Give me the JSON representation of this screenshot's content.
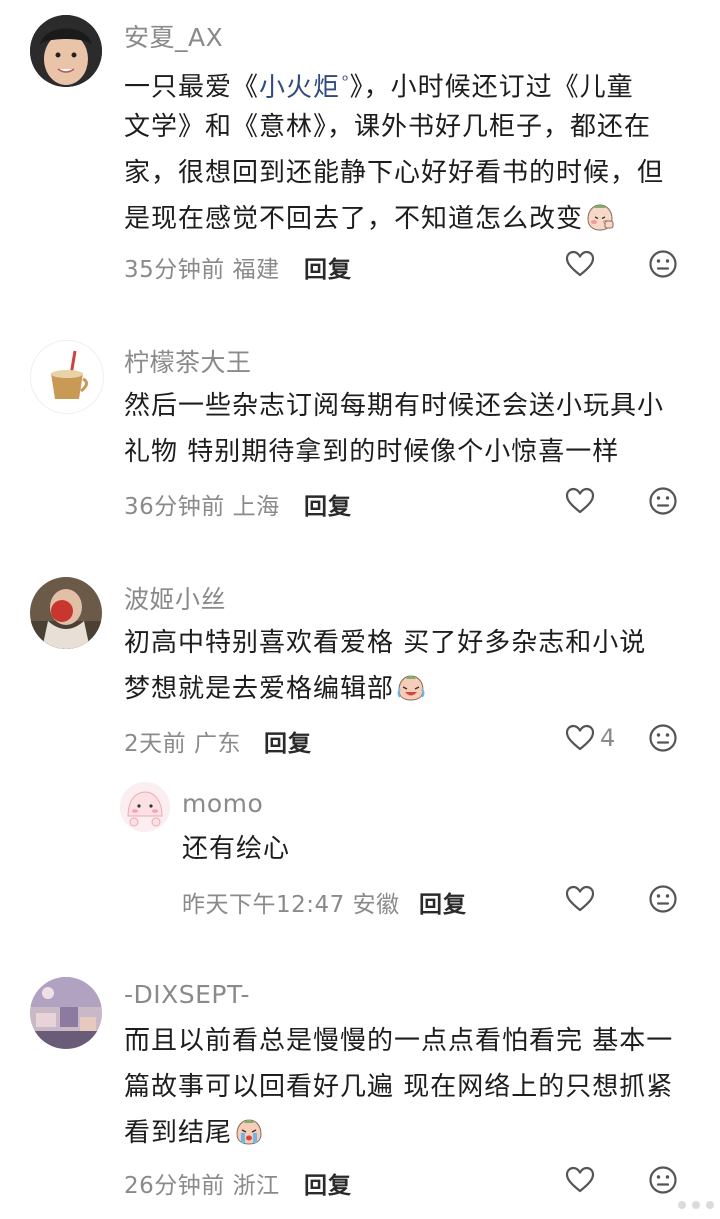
{
  "comments": [
    {
      "username": "安夏_AX",
      "lines": {
        "l1_before": "一只最爱《",
        "l1_link": "小火炬",
        "l1_after": "》，小时候还订过《儿童",
        "l2": "文学》和《意林》，课外书好几柜子，都还在",
        "l3": "家，很想回到还能静下心好好看书的时候，但",
        "l4": "是现在感觉不回去了，不知道怎么改变"
      },
      "meta": "35分钟前 福建",
      "reply_label": "回复"
    },
    {
      "username": "柠檬茶大王",
      "lines": {
        "l1": "然后一些杂志订阅每期有时候还会送小玩具小",
        "l2": "礼物 特别期待拿到的时候像个小惊喜一样"
      },
      "meta": "36分钟前 上海",
      "reply_label": "回复"
    },
    {
      "username": "波姬小丝",
      "lines": {
        "l1": "初高中特别喜欢看爱格 买了好多杂志和小说",
        "l2": "梦想就是去爱格编辑部"
      },
      "meta": "2天前 广东",
      "reply_label": "回复",
      "like_count": "4",
      "reply": {
        "username": "momo",
        "text": "还有绘心",
        "meta": "昨天下午12:47 安徽",
        "reply_label": "回复"
      }
    },
    {
      "username": "-DIXSEPT-",
      "lines": {
        "l1": "而且以前看总是慢慢的一点点看怕看完 基本一",
        "l2": "篇故事可以回看好几遍 现在网络上的只想抓紧",
        "l3": "看到结尾"
      },
      "meta": "26分钟前 浙江",
      "reply_label": "回复"
    }
  ],
  "icons": {
    "like": "heart-outline-icon",
    "dislike": "neutral-face-icon",
    "search": "search-icon",
    "emoji_shy": "shy-face-emoji",
    "emoji_cry": "laugh-cry-emoji",
    "emoji_sob": "crying-face-emoji"
  },
  "colors": {
    "link": "#2f4b80",
    "meta": "#8a8a8a",
    "text": "#1d1d1d"
  }
}
